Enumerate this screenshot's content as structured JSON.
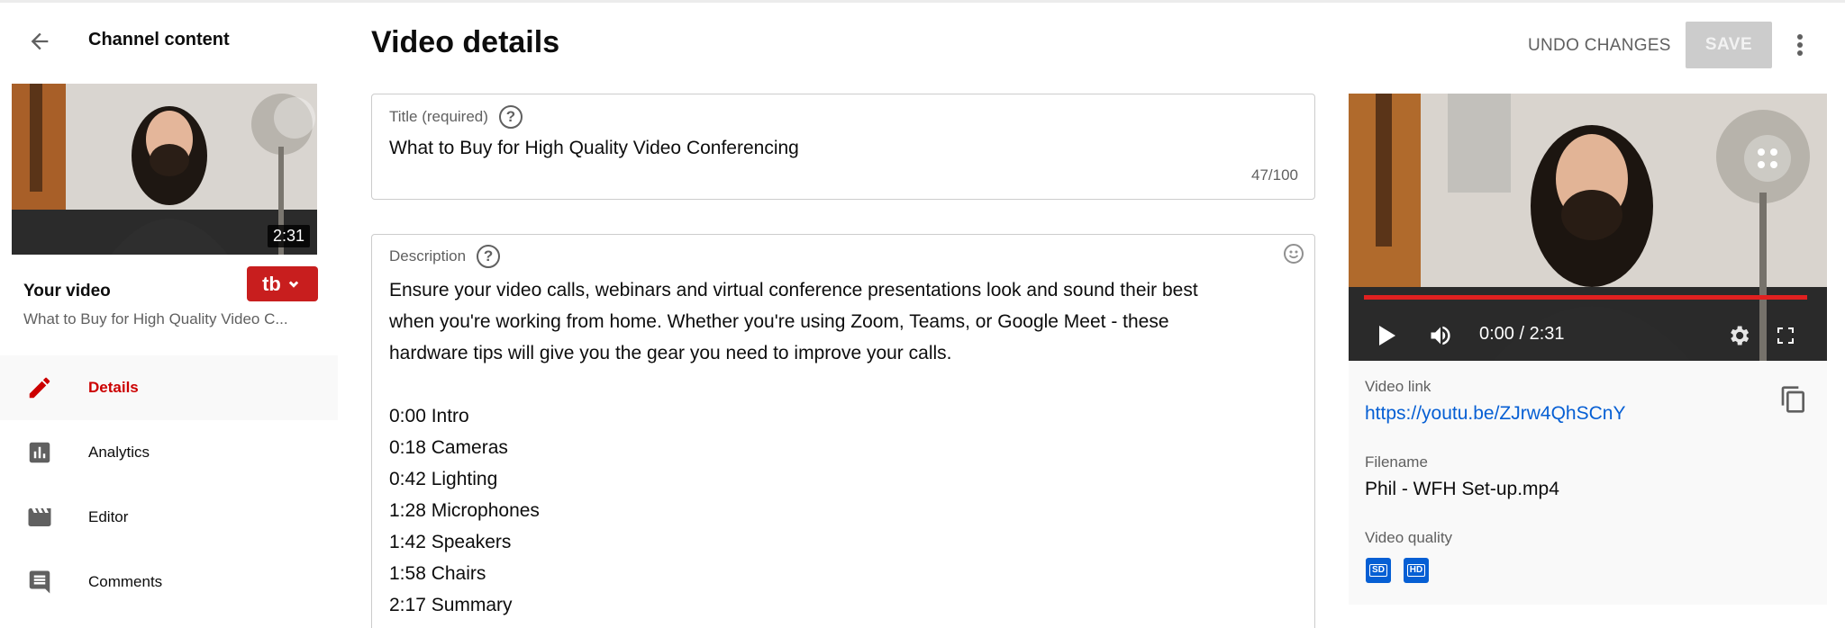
{
  "sidebar": {
    "title": "Channel content",
    "thumbnail_duration": "2:31",
    "your_video_label": "Your video",
    "video_title": "What to Buy for High Quality Video C...",
    "badge_text": "tb",
    "items": [
      {
        "label": "Details",
        "icon": "pencil-icon",
        "active": true
      },
      {
        "label": "Analytics",
        "icon": "analytics-icon",
        "active": false
      },
      {
        "label": "Editor",
        "icon": "clapperboard-icon",
        "active": false
      },
      {
        "label": "Comments",
        "icon": "comment-icon",
        "active": false
      }
    ]
  },
  "header": {
    "title": "Video details",
    "undo_label": "UNDO CHANGES",
    "save_label": "SAVE"
  },
  "form": {
    "title_label": "Title (required)",
    "title_value": "What to Buy for High Quality Video Conferencing",
    "title_count": "47/100",
    "description_label": "Description",
    "description_lines": [
      "Ensure your video calls, webinars and virtual conference presentations look and sound their best",
      "when you're working from home. Whether you're using Zoom, Teams, or Google Meet - these",
      "hardware tips will give you the gear you need to improve your calls.",
      "",
      "0:00 Intro",
      "0:18 Cameras",
      "0:42 Lighting",
      "1:28 Microphones",
      "1:42 Speakers",
      "1:58 Chairs",
      "2:17 Summary"
    ]
  },
  "player": {
    "time": "0:00 / 2:31",
    "progress": 0
  },
  "info": {
    "video_link_label": "Video link",
    "video_link": "https://youtu.be/ZJrw4QhSCnY",
    "filename_label": "Filename",
    "filename": "Phil - WFH Set-up.mp4",
    "quality_label": "Video quality",
    "qualities": [
      "SD",
      "HD"
    ]
  },
  "colors": {
    "accent_red": "#cc0000",
    "link_blue": "#065fd4",
    "progress_red": "#e02020"
  }
}
